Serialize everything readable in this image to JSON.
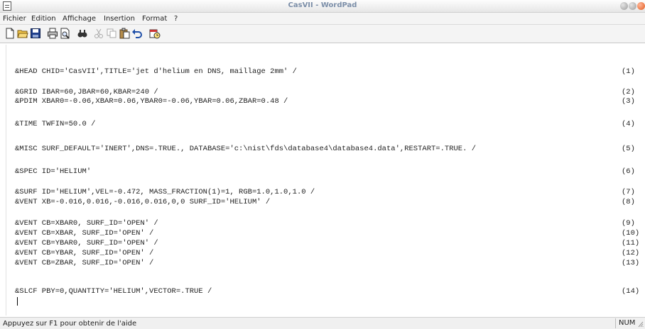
{
  "window": {
    "title": "CasVII - WordPad"
  },
  "menu": [
    "Fichier",
    "Edition",
    "Affichage",
    "Insertion",
    "Format",
    "?"
  ],
  "toolbar_icons": [
    "new-document-icon",
    "open-folder-icon",
    "save-icon",
    "print-icon",
    "print-preview-icon",
    "find-icon",
    "cut-icon",
    "copy-icon",
    "paste-icon",
    "undo-icon",
    "insert-datetime-icon"
  ],
  "document": {
    "lines": [
      {
        "text": "&HEAD CHID='CasVII',TITLE='jet d'helium en DNS, maillage 2mm' /",
        "num": "(1)"
      },
      {
        "text": "&GRID IBAR=60,JBAR=60,KBAR=240 /",
        "num": "(2)"
      },
      {
        "text": "&PDIM XBAR0=-0.06,XBAR=0.06,YBAR0=-0.06,YBAR=0.06,ZBAR=0.48 /",
        "num": "(3)"
      },
      {
        "text": "&TIME TWFIN=50.0 /",
        "num": "(4)"
      },
      {
        "text": "&MISC SURF_DEFAULT='INERT',DNS=.TRUE., DATABASE='c:\\nist\\fds\\database4\\database4.data',RESTART=.TRUE. /",
        "num": "(5)"
      },
      {
        "text": "&SPEC ID='HELIUM'",
        "num": "(6)"
      },
      {
        "text": "&SURF ID='HELIUM',VEL=-0.472, MASS_FRACTION(1)=1, RGB=1.0,1.0,1.0 /",
        "num": "(7)"
      },
      {
        "text": "&VENT XB=-0.016,0.016,-0.016,0.016,0,0 SURF_ID='HELIUM' /",
        "num": "(8)"
      },
      {
        "text": "&VENT CB=XBAR0, SURF_ID='OPEN' /",
        "num": "(9)"
      },
      {
        "text": "&VENT CB=XBAR, SURF_ID='OPEN' /",
        "num": "(10)"
      },
      {
        "text": "&VENT CB=YBAR0, SURF_ID='OPEN' /",
        "num": "(11)"
      },
      {
        "text": "&VENT CB=YBAR, SURF_ID='OPEN' /",
        "num": "(12)"
      },
      {
        "text": "&VENT CB=ZBAR, SURF_ID='OPEN' /",
        "num": "(13)"
      },
      {
        "text": "&SLCF PBY=0,QUANTITY='HELIUM',VECTOR=.TRUE /",
        "num": "(14)"
      }
    ]
  },
  "status": {
    "help_text": "Appuyez sur F1 pour obtenir de l'aide",
    "num_indicator": "NUM"
  },
  "colors": {
    "title_text": "#7b8ea8",
    "close_button": "#e35b1e"
  }
}
